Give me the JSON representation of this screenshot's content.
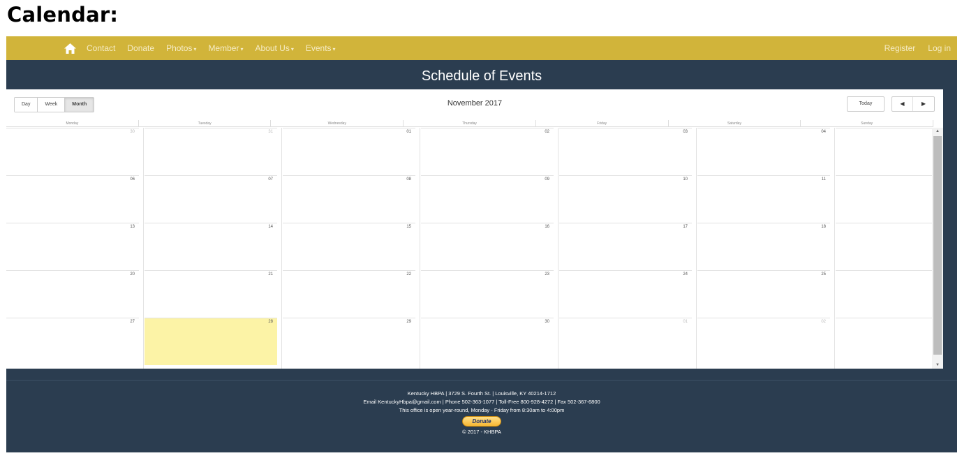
{
  "page": {
    "heading": "Calendar:"
  },
  "nav": {
    "home_icon": "home-icon",
    "items": [
      {
        "label": "Contact",
        "caret": ""
      },
      {
        "label": "Donate",
        "caret": ""
      },
      {
        "label": "Photos",
        "caret": "▾"
      },
      {
        "label": "Member",
        "caret": "▾"
      },
      {
        "label": "About Us",
        "caret": "▾"
      },
      {
        "label": "Events",
        "caret": "▾"
      }
    ],
    "right": [
      "Register",
      "Log in"
    ]
  },
  "schedule": {
    "title": "Schedule of Events"
  },
  "calendar": {
    "views": [
      "Day",
      "Week",
      "Month"
    ],
    "active_view": "Month",
    "month_title": "November 2017",
    "today_label": "Today",
    "prev_icon": "◀",
    "next_icon": "▶",
    "days_of_week": [
      "Monday",
      "Tuesday",
      "Wednesday",
      "Thursday",
      "Friday",
      "Saturday",
      "Sunday"
    ],
    "weeks": [
      [
        {
          "n": "30",
          "other": true
        },
        {
          "n": "31",
          "other": true
        },
        {
          "n": "01"
        },
        {
          "n": "02"
        },
        {
          "n": "03"
        },
        {
          "n": "04"
        },
        {
          "n": ""
        }
      ],
      [
        {
          "n": "06"
        },
        {
          "n": "07"
        },
        {
          "n": "08"
        },
        {
          "n": "09"
        },
        {
          "n": "10"
        },
        {
          "n": "11"
        },
        {
          "n": ""
        }
      ],
      [
        {
          "n": "13"
        },
        {
          "n": "14"
        },
        {
          "n": "15"
        },
        {
          "n": "16"
        },
        {
          "n": "17"
        },
        {
          "n": "18"
        },
        {
          "n": ""
        }
      ],
      [
        {
          "n": "20"
        },
        {
          "n": "21"
        },
        {
          "n": "22"
        },
        {
          "n": "23"
        },
        {
          "n": "24"
        },
        {
          "n": "25"
        },
        {
          "n": ""
        }
      ],
      [
        {
          "n": "27"
        },
        {
          "n": "28",
          "today": true
        },
        {
          "n": "29"
        },
        {
          "n": "30"
        },
        {
          "n": "01",
          "other": true
        },
        {
          "n": "02",
          "other": true
        },
        {
          "n": ""
        }
      ]
    ],
    "today_color": "#fcf3a6"
  },
  "footer": {
    "line1": "Kentucky HBPA | 3729 S. Fourth St. | Louisville, KY 40214-1712",
    "line2": "Email KentuckyHbpa@gmail.com | Phone 502-363-1077 | Toll-Free 800-928-4272 | Fax 502-367-6800",
    "line3": "This office is open year-round, Monday - Friday from 8:30am to 4:00pm",
    "donate_label": "Donate",
    "copyright": "© 2017 - KHBPA"
  },
  "colors": {
    "navbar": "#d1b43a",
    "frame": "#2b3d50",
    "today": "#fcf3a6"
  }
}
